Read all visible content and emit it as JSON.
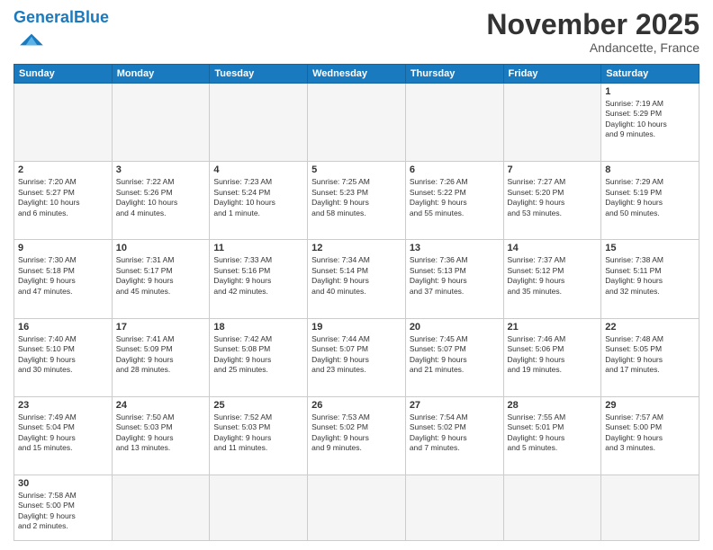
{
  "header": {
    "logo_general": "General",
    "logo_blue": "Blue",
    "month_title": "November 2025",
    "location": "Andancette, France"
  },
  "weekdays": [
    "Sunday",
    "Monday",
    "Tuesday",
    "Wednesday",
    "Thursday",
    "Friday",
    "Saturday"
  ],
  "weeks": [
    [
      {
        "day": "",
        "info": ""
      },
      {
        "day": "",
        "info": ""
      },
      {
        "day": "",
        "info": ""
      },
      {
        "day": "",
        "info": ""
      },
      {
        "day": "",
        "info": ""
      },
      {
        "day": "",
        "info": ""
      },
      {
        "day": "1",
        "info": "Sunrise: 7:19 AM\nSunset: 5:29 PM\nDaylight: 10 hours\nand 9 minutes."
      }
    ],
    [
      {
        "day": "2",
        "info": "Sunrise: 7:20 AM\nSunset: 5:27 PM\nDaylight: 10 hours\nand 6 minutes."
      },
      {
        "day": "3",
        "info": "Sunrise: 7:22 AM\nSunset: 5:26 PM\nDaylight: 10 hours\nand 4 minutes."
      },
      {
        "day": "4",
        "info": "Sunrise: 7:23 AM\nSunset: 5:24 PM\nDaylight: 10 hours\nand 1 minute."
      },
      {
        "day": "5",
        "info": "Sunrise: 7:25 AM\nSunset: 5:23 PM\nDaylight: 9 hours\nand 58 minutes."
      },
      {
        "day": "6",
        "info": "Sunrise: 7:26 AM\nSunset: 5:22 PM\nDaylight: 9 hours\nand 55 minutes."
      },
      {
        "day": "7",
        "info": "Sunrise: 7:27 AM\nSunset: 5:20 PM\nDaylight: 9 hours\nand 53 minutes."
      },
      {
        "day": "8",
        "info": "Sunrise: 7:29 AM\nSunset: 5:19 PM\nDaylight: 9 hours\nand 50 minutes."
      }
    ],
    [
      {
        "day": "9",
        "info": "Sunrise: 7:30 AM\nSunset: 5:18 PM\nDaylight: 9 hours\nand 47 minutes."
      },
      {
        "day": "10",
        "info": "Sunrise: 7:31 AM\nSunset: 5:17 PM\nDaylight: 9 hours\nand 45 minutes."
      },
      {
        "day": "11",
        "info": "Sunrise: 7:33 AM\nSunset: 5:16 PM\nDaylight: 9 hours\nand 42 minutes."
      },
      {
        "day": "12",
        "info": "Sunrise: 7:34 AM\nSunset: 5:14 PM\nDaylight: 9 hours\nand 40 minutes."
      },
      {
        "day": "13",
        "info": "Sunrise: 7:36 AM\nSunset: 5:13 PM\nDaylight: 9 hours\nand 37 minutes."
      },
      {
        "day": "14",
        "info": "Sunrise: 7:37 AM\nSunset: 5:12 PM\nDaylight: 9 hours\nand 35 minutes."
      },
      {
        "day": "15",
        "info": "Sunrise: 7:38 AM\nSunset: 5:11 PM\nDaylight: 9 hours\nand 32 minutes."
      }
    ],
    [
      {
        "day": "16",
        "info": "Sunrise: 7:40 AM\nSunset: 5:10 PM\nDaylight: 9 hours\nand 30 minutes."
      },
      {
        "day": "17",
        "info": "Sunrise: 7:41 AM\nSunset: 5:09 PM\nDaylight: 9 hours\nand 28 minutes."
      },
      {
        "day": "18",
        "info": "Sunrise: 7:42 AM\nSunset: 5:08 PM\nDaylight: 9 hours\nand 25 minutes."
      },
      {
        "day": "19",
        "info": "Sunrise: 7:44 AM\nSunset: 5:07 PM\nDaylight: 9 hours\nand 23 minutes."
      },
      {
        "day": "20",
        "info": "Sunrise: 7:45 AM\nSunset: 5:07 PM\nDaylight: 9 hours\nand 21 minutes."
      },
      {
        "day": "21",
        "info": "Sunrise: 7:46 AM\nSunset: 5:06 PM\nDaylight: 9 hours\nand 19 minutes."
      },
      {
        "day": "22",
        "info": "Sunrise: 7:48 AM\nSunset: 5:05 PM\nDaylight: 9 hours\nand 17 minutes."
      }
    ],
    [
      {
        "day": "23",
        "info": "Sunrise: 7:49 AM\nSunset: 5:04 PM\nDaylight: 9 hours\nand 15 minutes."
      },
      {
        "day": "24",
        "info": "Sunrise: 7:50 AM\nSunset: 5:03 PM\nDaylight: 9 hours\nand 13 minutes."
      },
      {
        "day": "25",
        "info": "Sunrise: 7:52 AM\nSunset: 5:03 PM\nDaylight: 9 hours\nand 11 minutes."
      },
      {
        "day": "26",
        "info": "Sunrise: 7:53 AM\nSunset: 5:02 PM\nDaylight: 9 hours\nand 9 minutes."
      },
      {
        "day": "27",
        "info": "Sunrise: 7:54 AM\nSunset: 5:02 PM\nDaylight: 9 hours\nand 7 minutes."
      },
      {
        "day": "28",
        "info": "Sunrise: 7:55 AM\nSunset: 5:01 PM\nDaylight: 9 hours\nand 5 minutes."
      },
      {
        "day": "29",
        "info": "Sunrise: 7:57 AM\nSunset: 5:00 PM\nDaylight: 9 hours\nand 3 minutes."
      }
    ],
    [
      {
        "day": "30",
        "info": "Sunrise: 7:58 AM\nSunset: 5:00 PM\nDaylight: 9 hours\nand 2 minutes."
      },
      {
        "day": "",
        "info": ""
      },
      {
        "day": "",
        "info": ""
      },
      {
        "day": "",
        "info": ""
      },
      {
        "day": "",
        "info": ""
      },
      {
        "day": "",
        "info": ""
      },
      {
        "day": "",
        "info": ""
      }
    ]
  ]
}
